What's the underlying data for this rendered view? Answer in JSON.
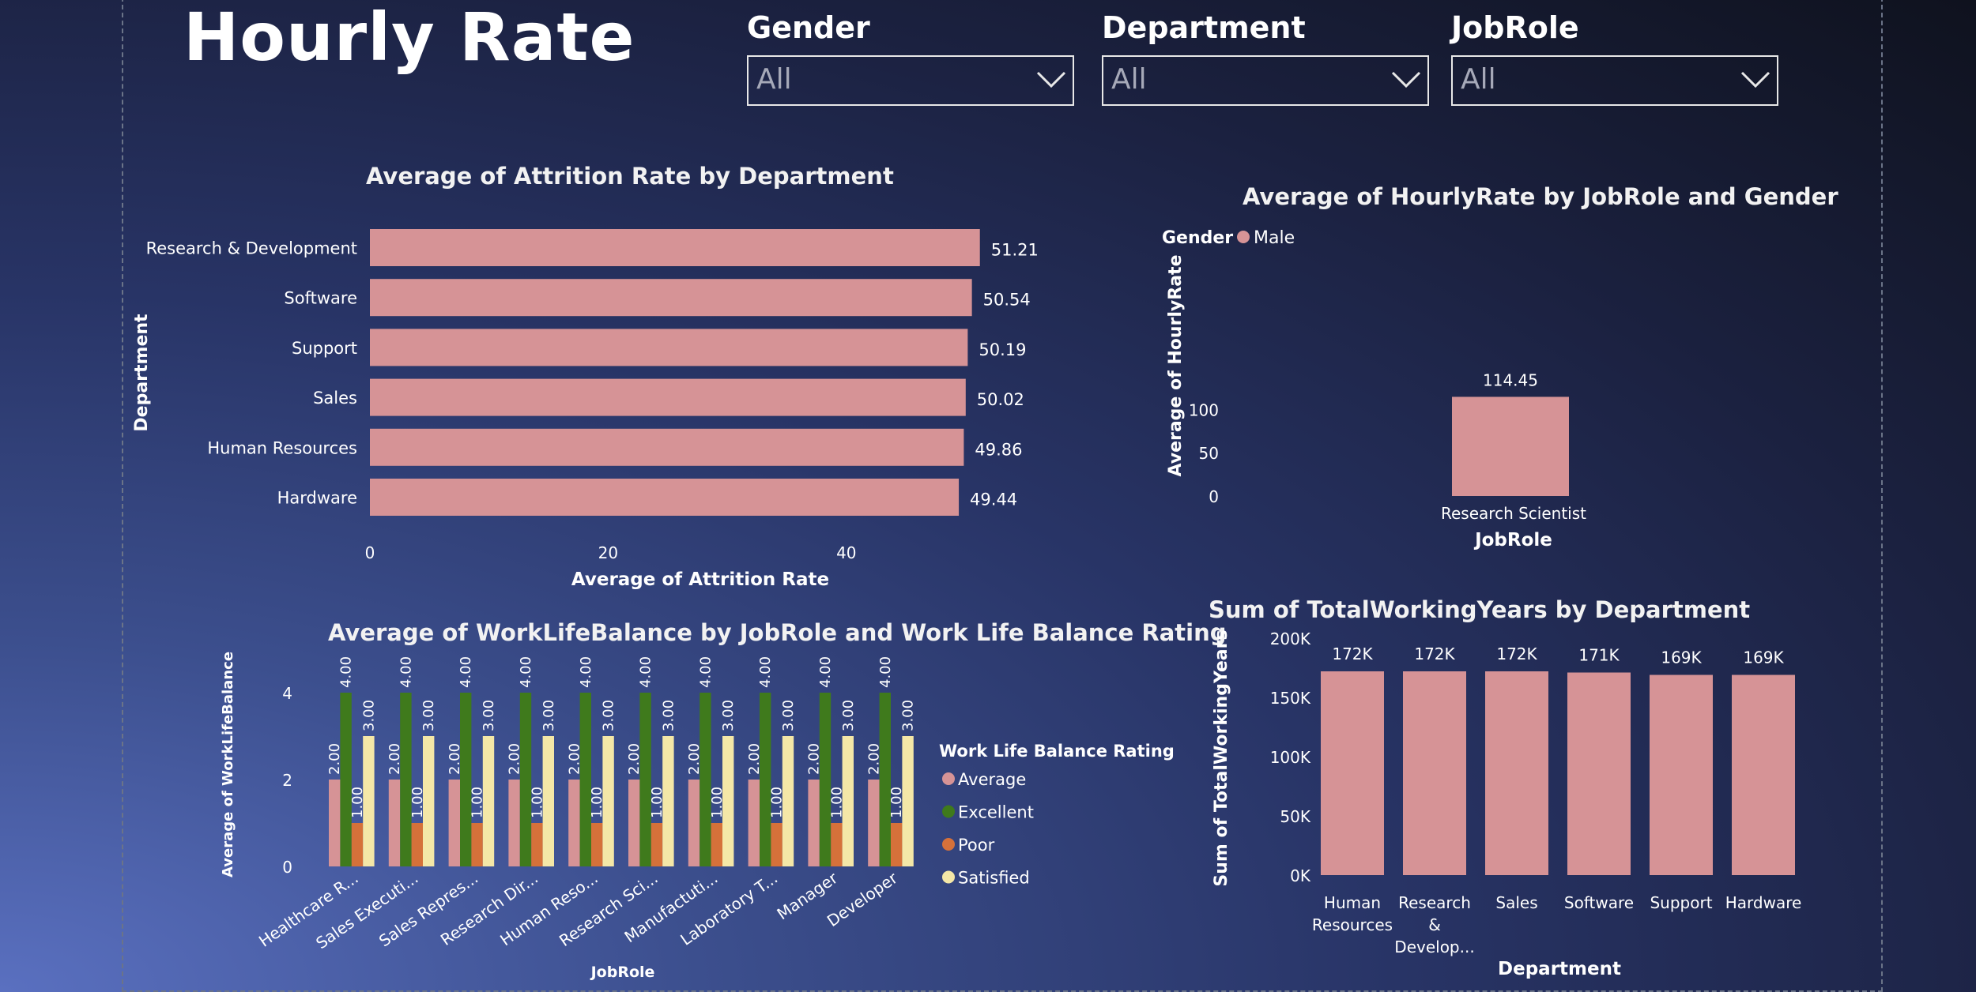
{
  "page": {
    "title": "Hourly Rate",
    "background_colors": [
      "#5a70c0",
      "#283466",
      "#0f121e"
    ]
  },
  "slicers": [
    {
      "label": "Gender",
      "value": "All",
      "icon": "chevron-down-icon"
    },
    {
      "label": "Department",
      "value": "All",
      "icon": "chevron-down-icon"
    },
    {
      "label": "JobRole",
      "value": "All",
      "icon": "chevron-down-icon"
    }
  ],
  "colors": {
    "bar": "#d69396",
    "Average": "#d69396",
    "Excellent": "#3f7a1c",
    "Poor": "#d5713a",
    "Satisfied": "#f4e7a7"
  },
  "chart_data": [
    {
      "id": "attrition",
      "type": "bar",
      "orientation": "horizontal",
      "title": "Average of Attrition Rate by Department",
      "xlabel": "Average of Attrition Rate",
      "ylabel": "Department",
      "categories": [
        "Research & Development",
        "Software",
        "Support",
        "Sales",
        "Human Resources",
        "Hardware"
      ],
      "values": [
        51.21,
        50.54,
        50.19,
        50.02,
        49.86,
        49.44
      ],
      "value_labels": [
        "51.21",
        "50.54",
        "50.19",
        "50.02",
        "49.86",
        "49.44"
      ],
      "xlim": [
        0,
        55
      ],
      "xticks": [
        0,
        20,
        40
      ],
      "xtick_labels": [
        "0",
        "20",
        "40"
      ]
    },
    {
      "id": "hourly",
      "type": "bar",
      "title": "Average of HourlyRate by JobRole and Gender",
      "legend_title": "Gender",
      "legend": [
        "Male"
      ],
      "legend_position": "top-left",
      "xlabel": "JobRole",
      "ylabel": "Average of HourlyRate",
      "categories": [
        "Research Scientist"
      ],
      "series": [
        {
          "name": "Male",
          "values": [
            114.45
          ]
        }
      ],
      "value_labels": [
        "114.45"
      ],
      "ylim": [
        0,
        114.45
      ],
      "yticks": [
        0,
        50,
        100
      ],
      "ytick_labels": [
        "0",
        "50",
        "100"
      ]
    },
    {
      "id": "worklife",
      "type": "bar",
      "title": "Average of WorkLifeBalance by JobRole and Work Life Balance Rating",
      "xlabel": "JobRole",
      "ylabel": "Average of WorkLifeBalance",
      "legend_title": "Work Life Balance Rating",
      "legend_position": "right",
      "categories": [
        "Healthcare R...",
        "Sales Executi...",
        "Sales Repres...",
        "Research Dir...",
        "Human Reso...",
        "Research Sci...",
        "Manufactuti...",
        "Laboratory T...",
        "Manager",
        "Developer"
      ],
      "series": [
        {
          "name": "Average",
          "values": [
            2,
            2,
            2,
            2,
            2,
            2,
            2,
            2,
            2,
            2
          ],
          "labels": [
            "2.00",
            "2.00",
            "2.00",
            "2.00",
            "2.00",
            "2.00",
            "2.00",
            "2.00",
            "2.00",
            "2.00"
          ]
        },
        {
          "name": "Excellent",
          "values": [
            4,
            4,
            4,
            4,
            4,
            4,
            4,
            4,
            4,
            4
          ],
          "labels": [
            "4.00",
            "4.00",
            "4.00",
            "4.00",
            "4.00",
            "4.00",
            "4.00",
            "4.00",
            "4.00",
            "4.00"
          ]
        },
        {
          "name": "Poor",
          "values": [
            1,
            1,
            1,
            1,
            1,
            1,
            1,
            1,
            1,
            1
          ],
          "labels": [
            "1.00",
            "1.00",
            "1.00",
            "1.00",
            "1.00",
            "1.00",
            "1.00",
            "1.00",
            "1.00",
            "1.00"
          ]
        },
        {
          "name": "Satisfied",
          "values": [
            3,
            3,
            3,
            3,
            3,
            3,
            3,
            3,
            3,
            3
          ],
          "labels": [
            "3.00",
            "3.00",
            "3.00",
            "3.00",
            "3.00",
            "3.00",
            "3.00",
            "3.00",
            "3.00",
            "3.00"
          ]
        }
      ],
      "ylim": [
        0,
        4
      ],
      "yticks": [
        0,
        2,
        4
      ],
      "ytick_labels": [
        "0",
        "2",
        "4"
      ]
    },
    {
      "id": "totalyears",
      "type": "bar",
      "title": "Sum of TotalWorkingYears by Department",
      "xlabel": "Department",
      "ylabel": "Sum of TotalWorkingYears",
      "categories": [
        [
          "Human",
          "Resources"
        ],
        [
          "Research",
          "&",
          "Develop..."
        ],
        [
          "Sales"
        ],
        [
          "Software"
        ],
        [
          "Support"
        ],
        [
          "Hardware"
        ]
      ],
      "values": [
        172000,
        172000,
        172000,
        171000,
        169000,
        169000
      ],
      "value_labels": [
        "172K",
        "172K",
        "172K",
        "171K",
        "169K",
        "169K"
      ],
      "ylim": [
        0,
        200000
      ],
      "yticks": [
        0,
        50000,
        100000,
        150000,
        200000
      ],
      "ytick_labels": [
        "0K",
        "50K",
        "100K",
        "150K",
        "200K"
      ]
    }
  ]
}
